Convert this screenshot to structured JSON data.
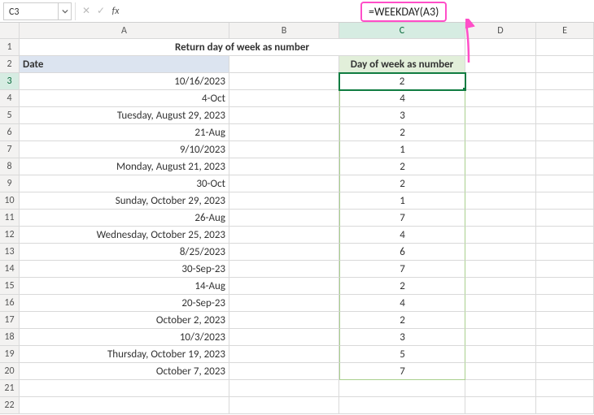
{
  "namebox": "C3",
  "formula_display": "=WEEKDAY(A3)",
  "columns": [
    "A",
    "B",
    "C",
    "D",
    "E"
  ],
  "rows": [
    "1",
    "2",
    "3",
    "4",
    "5",
    "6",
    "7",
    "8",
    "9",
    "10",
    "11",
    "12",
    "13",
    "14",
    "15",
    "16",
    "17",
    "18",
    "19",
    "20",
    "21",
    "22"
  ],
  "title": "Return day of week as number",
  "headers": {
    "date": "Date",
    "num": "Day of week as number"
  },
  "data": [
    {
      "date": "10/16/2023",
      "num": "2"
    },
    {
      "date": "4-Oct",
      "num": "4"
    },
    {
      "date": "Tuesday, August 29, 2023",
      "num": "3"
    },
    {
      "date": "21-Aug",
      "num": "2"
    },
    {
      "date": "9/10/2023",
      "num": "1"
    },
    {
      "date": "Monday, August 21, 2023",
      "num": "2"
    },
    {
      "date": "30-Oct",
      "num": "2"
    },
    {
      "date": "Sunday, October 29, 2023",
      "num": "1"
    },
    {
      "date": "26-Aug",
      "num": "7"
    },
    {
      "date": "Wednesday, October 25, 2023",
      "num": "4"
    },
    {
      "date": "8/25/2023",
      "num": "6"
    },
    {
      "date": "30-Sep-23",
      "num": "7"
    },
    {
      "date": "14-Aug",
      "num": "2"
    },
    {
      "date": "20-Sep-23",
      "num": "4"
    },
    {
      "date": "October 2, 2023",
      "num": "2"
    },
    {
      "date": "10/3/2023",
      "num": "3"
    },
    {
      "date": "Thursday, October 19, 2023",
      "num": "5"
    },
    {
      "date": "October 7, 2023",
      "num": "7"
    }
  ],
  "chart_data": {
    "type": "table",
    "title": "Return day of week as number",
    "columns": [
      "Date",
      "Day of week as number"
    ],
    "rows": [
      [
        "10/16/2023",
        2
      ],
      [
        "4-Oct",
        4
      ],
      [
        "Tuesday, August 29, 2023",
        3
      ],
      [
        "21-Aug",
        2
      ],
      [
        "9/10/2023",
        1
      ],
      [
        "Monday, August 21, 2023",
        2
      ],
      [
        "30-Oct",
        2
      ],
      [
        "Sunday, October 29, 2023",
        1
      ],
      [
        "26-Aug",
        7
      ],
      [
        "Wednesday, October 25, 2023",
        4
      ],
      [
        "8/25/2023",
        6
      ],
      [
        "30-Sep-23",
        7
      ],
      [
        "14-Aug",
        2
      ],
      [
        "20-Sep-23",
        4
      ],
      [
        "October 2, 2023",
        2
      ],
      [
        "10/3/2023",
        3
      ],
      [
        "Thursday, October 19, 2023",
        5
      ],
      [
        "October 7, 2023",
        7
      ]
    ],
    "formula": "=WEEKDAY(A3)"
  }
}
